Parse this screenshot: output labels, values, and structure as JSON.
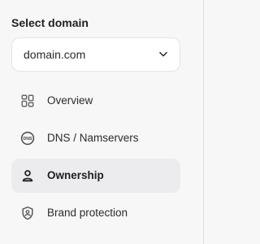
{
  "sidebar": {
    "title": "Select domain",
    "domain_select": {
      "value": "domain.com"
    },
    "items": [
      {
        "label": "Overview"
      },
      {
        "label": "DNS / Namservers"
      },
      {
        "label": "Ownership"
      },
      {
        "label": "Brand protection"
      }
    ]
  },
  "icons": {
    "overview": "grid-icon",
    "dns": "dns-icon",
    "ownership": "user-icon",
    "brand": "shield-icon",
    "select": "chevron-down-icon"
  },
  "colors": {
    "background": "#f7f7f8",
    "active_item": "#ececef",
    "border": "#e2e3e7",
    "text": "#222222"
  }
}
